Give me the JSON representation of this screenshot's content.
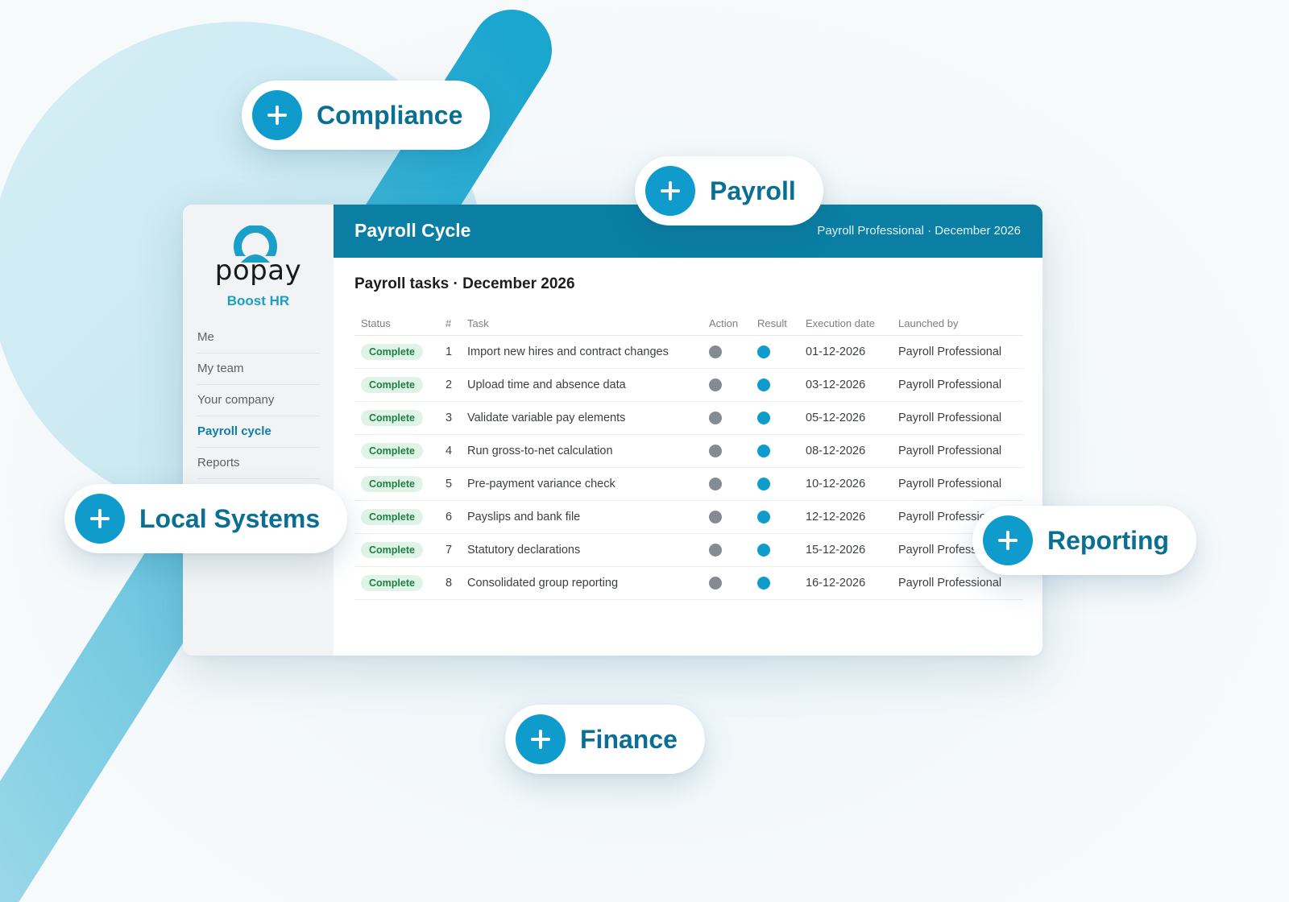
{
  "colors": {
    "accent": "#0a7ea3",
    "plus_button": "#0f9bcb",
    "complete_badge_bg": "#dff4e6",
    "complete_badge_text": "#1d7f45",
    "action_dot": "#858b93",
    "result_dot": "#0f9bcb"
  },
  "sidebar": {
    "logo_word": "popay",
    "logo_tagline": "Boost HR",
    "items": [
      {
        "label": "Me",
        "active": false
      },
      {
        "label": "My team",
        "active": false
      },
      {
        "label": "Your company",
        "active": false
      },
      {
        "label": "Payroll cycle",
        "active": true
      },
      {
        "label": "Reports",
        "active": false
      }
    ]
  },
  "header": {
    "title": "Payroll Cycle",
    "meta": "Payroll Professional · December 2026"
  },
  "main": {
    "section_title": "Payroll tasks · December 2026",
    "columns": [
      "Status",
      "#",
      "Task",
      "Action",
      "Result",
      "Execution date",
      "Launched by"
    ],
    "rows": [
      {
        "status": "Complete",
        "num": "1",
        "task": "Import new hires and contract changes",
        "action": "done",
        "result": "done",
        "date": "01-12-2026",
        "launched_by": "Payroll Professional"
      },
      {
        "status": "Complete",
        "num": "2",
        "task": "Upload time and absence data",
        "action": "done",
        "result": "done",
        "date": "03-12-2026",
        "launched_by": "Payroll Professional"
      },
      {
        "status": "Complete",
        "num": "3",
        "task": "Validate variable pay elements",
        "action": "done",
        "result": "done",
        "date": "05-12-2026",
        "launched_by": "Payroll Professional"
      },
      {
        "status": "Complete",
        "num": "4",
        "task": "Run gross-to-net calculation",
        "action": "done",
        "result": "done",
        "date": "08-12-2026",
        "launched_by": "Payroll Professional"
      },
      {
        "status": "Complete",
        "num": "5",
        "task": "Pre-payment variance check",
        "action": "done",
        "result": "done",
        "date": "10-12-2026",
        "launched_by": "Payroll Professional"
      },
      {
        "status": "Complete",
        "num": "6",
        "task": "Payslips and bank file",
        "action": "done",
        "result": "done",
        "date": "12-12-2026",
        "launched_by": "Payroll Professional"
      },
      {
        "status": "Complete",
        "num": "7",
        "task": "Statutory declarations",
        "action": "done",
        "result": "done",
        "date": "15-12-2026",
        "launched_by": "Payroll Professional"
      },
      {
        "status": "Complete",
        "num": "8",
        "task": "Consolidated group reporting",
        "action": "done",
        "result": "done",
        "date": "16-12-2026",
        "launched_by": "Payroll Professional"
      }
    ]
  },
  "pills": {
    "compliance": "Compliance",
    "payroll": "Payroll",
    "local_systems": "Local Systems",
    "reporting": "Reporting",
    "finance": "Finance"
  }
}
